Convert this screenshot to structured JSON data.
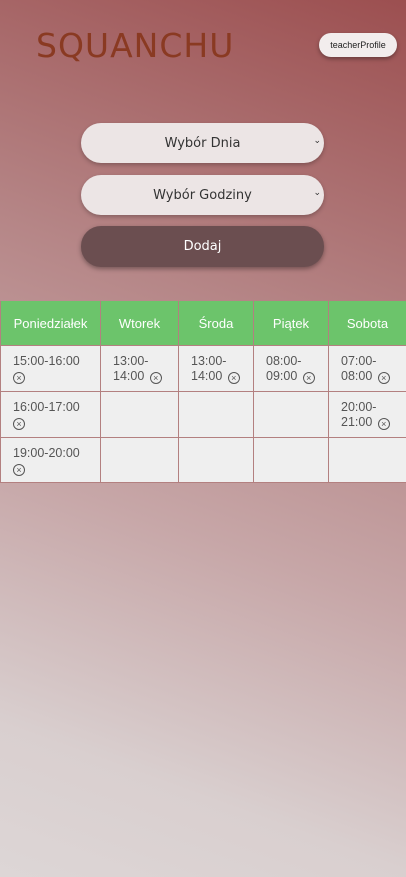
{
  "header": {
    "logo_text": "SQUANCHU",
    "profile_button": "teacherProfile"
  },
  "form": {
    "day_select": {
      "selected": "Wybór Dnia",
      "chevron_icon": "chevron-down-icon"
    },
    "hour_select": {
      "selected": "Wybór Godziny",
      "chevron_icon": "chevron-down-icon"
    },
    "add_button": "Dodaj"
  },
  "schedule": {
    "header_color": "#6cc46b",
    "columns": [
      "Poniedziałek",
      "Wtorek",
      "Środa",
      "Piątek",
      "Sobota"
    ],
    "rows": [
      [
        "15:00-16:00",
        "13:00-14:00",
        "13:00-14:00",
        "08:00-09:00",
        "07:00-08:00"
      ],
      [
        "16:00-17:00",
        "",
        "",
        "",
        "20:00-21:00"
      ],
      [
        "19:00-20:00",
        "",
        "",
        "",
        ""
      ]
    ],
    "delete_icon": "close-circle-icon"
  }
}
